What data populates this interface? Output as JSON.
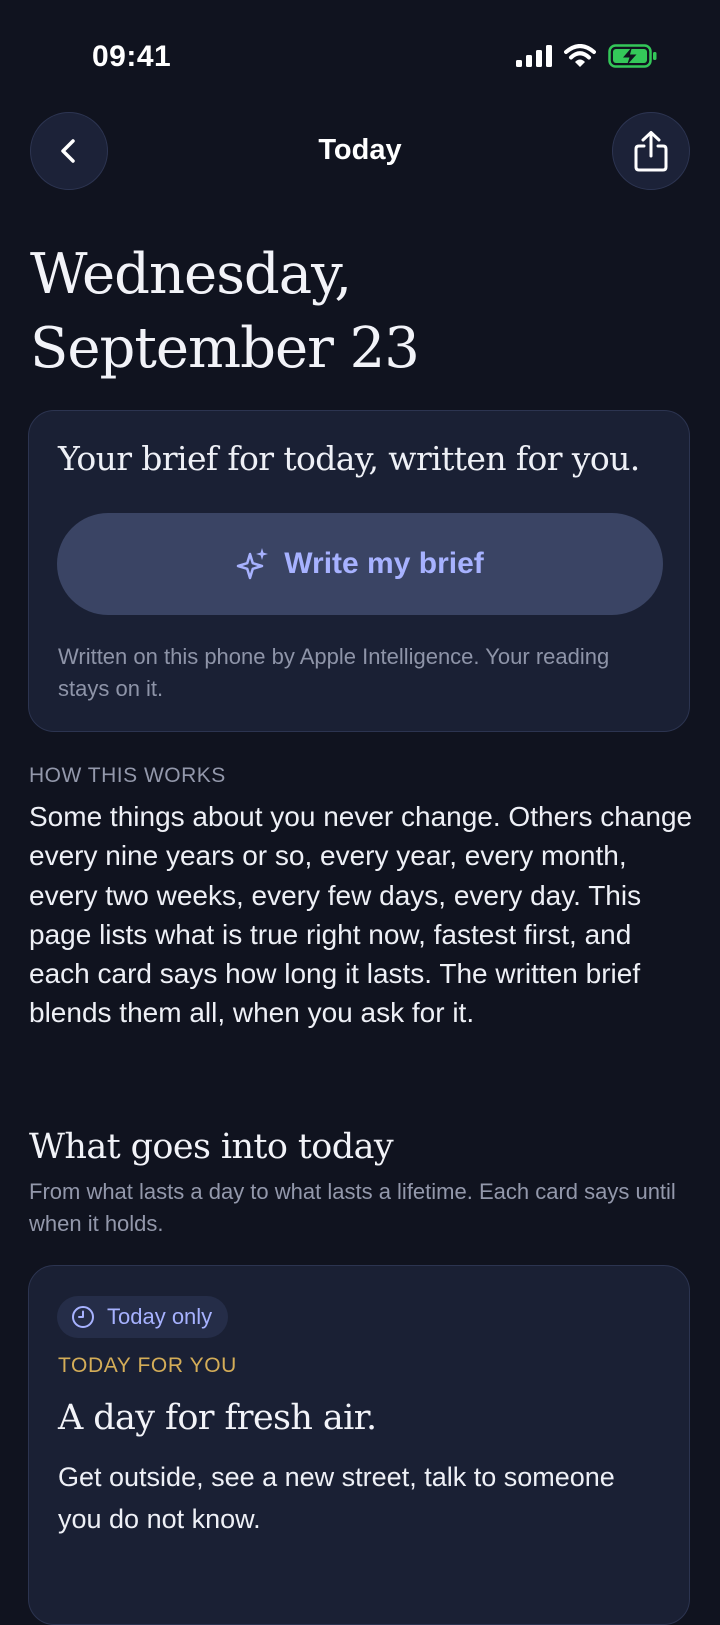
{
  "status_bar": {
    "time": "09:41"
  },
  "nav": {
    "title": "Today"
  },
  "date": {
    "line1": "Wednesday,",
    "line2": "September 23"
  },
  "brief": {
    "heading": "Your brief for today, written for you.",
    "button_label": "Write my brief",
    "note": "Written on this phone by Apple Intelligence. Your reading stays on it."
  },
  "how": {
    "eyebrow": "HOW THIS WORKS",
    "body": "Some things about you never change. Others change every nine years or so, every year, every month, every two weeks, every few days, every day. This page lists what is true right now, fastest first, and each card says how long it lasts. The written brief blends them all, when you ask for it."
  },
  "goes": {
    "title": "What goes into today",
    "subtitle": "From what lasts a day to what lasts a lifetime. Each card says until when it holds."
  },
  "card": {
    "pill_label": "Today only",
    "eyebrow": "TODAY FOR YOU",
    "heading": "A day for fresh air.",
    "body": "Get outside, see a new street, talk to someone you do not know."
  },
  "icons": {
    "back": "chevron-left-icon",
    "share": "share-icon",
    "sparkle": "sparkles-icon",
    "clock": "clock-icon"
  },
  "colors": {
    "background": "#10131f",
    "card": "#1a2034",
    "accent": "#a7b2ff",
    "eyebrow_gold": "#d4ad58",
    "battery_green": "#34c759"
  }
}
